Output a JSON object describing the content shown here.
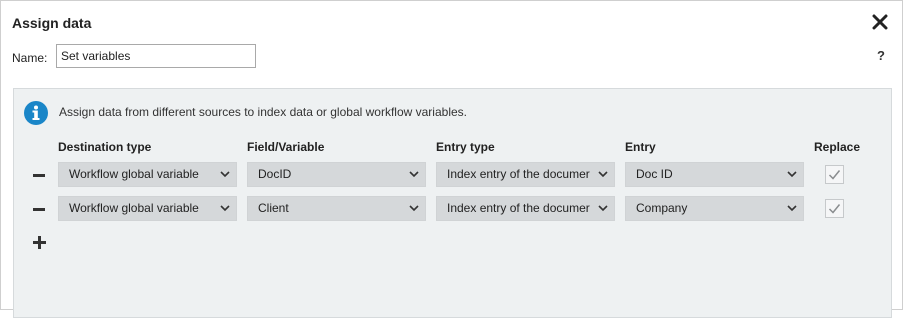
{
  "dialog": {
    "title": "Assign data",
    "close_icon": "close-icon",
    "help_label": "?"
  },
  "name": {
    "label": "Name:",
    "value": "Set variables"
  },
  "panel": {
    "info_icon": "info-icon",
    "info_text": "Assign data from different sources to index data or global workflow variables.",
    "columns": {
      "destination_type": "Destination type",
      "field_variable": "Field/Variable",
      "entry_type": "Entry type",
      "entry": "Entry",
      "replace": "Replace"
    },
    "rows": [
      {
        "destination_type": "Workflow global variable",
        "field_variable": "DocID",
        "entry_type": "Index entry of the documer",
        "entry": "Doc ID",
        "replace": true
      },
      {
        "destination_type": "Workflow global variable",
        "field_variable": "Client",
        "entry_type": "Index entry of the documer",
        "entry": "Company",
        "replace": true
      }
    ]
  },
  "colors": {
    "info_blue": "#1a86c8",
    "panel_bg": "#eef1f2",
    "select_bg": "#d5d8da"
  }
}
